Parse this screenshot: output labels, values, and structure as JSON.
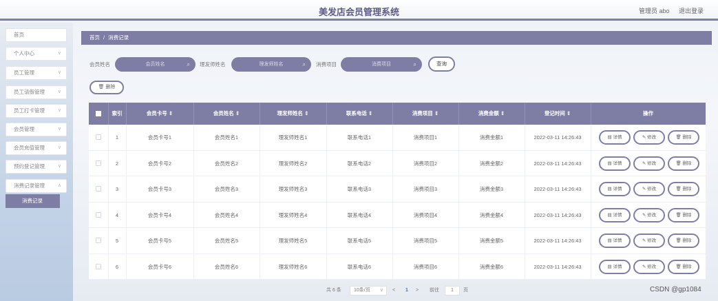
{
  "header": {
    "title": "美发店会员管理系统",
    "admin": "管理员 abo",
    "logout": "退出登录"
  },
  "sidebar": {
    "items": [
      {
        "label": "首页",
        "chevron": false
      },
      {
        "label": "个人中心",
        "chevron": true
      },
      {
        "label": "员工管理",
        "chevron": true
      },
      {
        "label": "员工请假管理",
        "chevron": true
      },
      {
        "label": "员工打卡管理",
        "chevron": true
      },
      {
        "label": "会员管理",
        "chevron": true
      },
      {
        "label": "会员充值管理",
        "chevron": true
      },
      {
        "label": "预约登记管理",
        "chevron": true
      },
      {
        "label": "消费记录管理",
        "chevron": true
      }
    ],
    "active_sub": "消费记录"
  },
  "breadcrumb": {
    "home": "首页",
    "separator": "/",
    "current": "消费记录"
  },
  "search": {
    "member_label": "会员姓名",
    "member_placeholder": "会员姓名",
    "stylist_label": "理发师姓名",
    "stylist_placeholder": "理发师姓名",
    "item_label": "消费项目",
    "item_placeholder": "消费项目",
    "query_button": "查询"
  },
  "actions": {
    "delete_button": "删除"
  },
  "table": {
    "headers": {
      "index": "索引",
      "card": "会员卡号 ⇕",
      "name": "会员姓名 ⇕",
      "stylist": "理发师姓名 ⇕",
      "phone": "联系电话 ⇕",
      "item": "消费项目 ⇕",
      "amount": "消费金额 ⇕",
      "time": "登记时间 ⇕",
      "ops": "操作"
    },
    "rows": [
      {
        "index": "1",
        "card": "会员卡号1",
        "name": "会员姓名1",
        "stylist": "理发师姓名1",
        "phone": "联系电话1",
        "item": "消费项目1",
        "amount": "消费金额1",
        "time": "2022-03-11 14:26:43"
      },
      {
        "index": "2",
        "card": "会员卡号2",
        "name": "会员姓名2",
        "stylist": "理发师姓名2",
        "phone": "联系电话2",
        "item": "消费项目2",
        "amount": "消费金额2",
        "time": "2022-03-11 14:26:43"
      },
      {
        "index": "3",
        "card": "会员卡号3",
        "name": "会员姓名3",
        "stylist": "理发师姓名3",
        "phone": "联系电话3",
        "item": "消费项目3",
        "amount": "消费金额3",
        "time": "2022-03-11 14:26:43"
      },
      {
        "index": "4",
        "card": "会员卡号4",
        "name": "会员姓名4",
        "stylist": "理发师姓名4",
        "phone": "联系电话4",
        "item": "消费项目4",
        "amount": "消费金额4",
        "time": "2022-03-11 14:26:43"
      },
      {
        "index": "5",
        "card": "会员卡号5",
        "name": "会员姓名5",
        "stylist": "理发师姓名5",
        "phone": "联系电话5",
        "item": "消费项目5",
        "amount": "消费金额5",
        "time": "2022-03-11 14:26:43"
      },
      {
        "index": "6",
        "card": "会员卡号6",
        "name": "会员姓名6",
        "stylist": "理发师姓名6",
        "phone": "联系电话6",
        "item": "消费项目6",
        "amount": "消费金额6",
        "time": "2022-03-11 14:26:43"
      }
    ],
    "row_actions": {
      "detail": "详情",
      "edit": "修改",
      "delete": "删除"
    }
  },
  "pagination": {
    "total": "共 6 条",
    "page_size": "10条/页",
    "prev": "<",
    "current_page": "1",
    "next": ">",
    "goto_label": "前往",
    "goto_value": "1",
    "page_unit": "页"
  },
  "watermark": "CSDN @gp1084",
  "colors": {
    "accent": "#7e7ea5",
    "link": "#4a67c8"
  }
}
